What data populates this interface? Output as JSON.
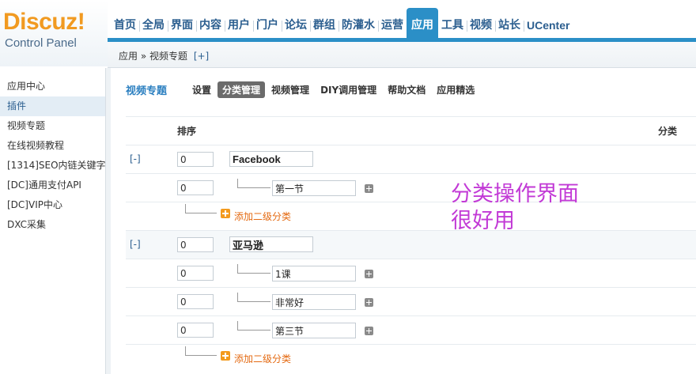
{
  "logo": {
    "brand": "Discuz!",
    "subtitle": "Control Panel"
  },
  "topnav": [
    "首页",
    "全局",
    "界面",
    "内容",
    "用户",
    "门户",
    "论坛",
    "群组",
    "防灌水",
    "运营",
    "应用",
    "工具",
    "视频",
    "站长",
    "UCenter"
  ],
  "topnav_active": "应用",
  "breadcrumb": {
    "path": "应用 » 视频专题",
    "add": "[+]"
  },
  "sidebar": {
    "items": [
      "应用中心",
      "插件",
      "视频专题",
      "在线视频教程",
      "[1314]SEO内链关键字",
      "[DC]通用支付API",
      "[DC]VIP中心",
      "DXC采集"
    ],
    "active": "插件"
  },
  "subnav": {
    "title": "视频专题",
    "tabs": [
      "设置",
      "分类管理",
      "视频管理",
      "DIY调用管理",
      "帮助文档",
      "应用精选"
    ],
    "active": "分类管理"
  },
  "table": {
    "col_order": "排序",
    "col_category": "分类",
    "collapse_label": "[-]",
    "add_sub_label": "添加二级分类",
    "groups": [
      {
        "order": "0",
        "name": "Facebook",
        "children": [
          {
            "order": "0",
            "name": "第一节"
          }
        ]
      },
      {
        "order": "0",
        "name": "亚马逊",
        "children": [
          {
            "order": "0",
            "name": "1课"
          },
          {
            "order": "0",
            "name": "非常好"
          },
          {
            "order": "0",
            "name": "第三节"
          }
        ]
      }
    ]
  },
  "annotation": {
    "line1": "分类操作界面",
    "line2": "很好用"
  },
  "colors": {
    "accent": "#2b8fc7",
    "logo": "#f19a21",
    "link": "#2b5e8f",
    "add": "#e46a12",
    "annotation": "#c23ad6"
  }
}
